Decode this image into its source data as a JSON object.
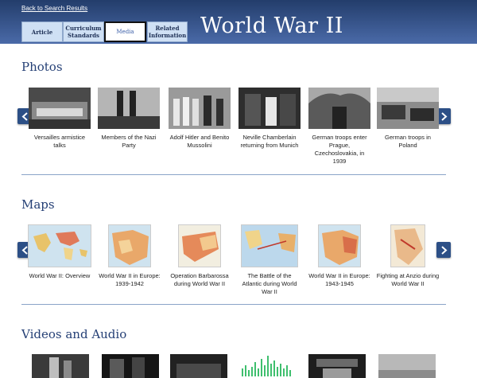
{
  "header": {
    "back_link": "Back to Search Results",
    "title": "World War II",
    "tabs": [
      {
        "label_line1": "Article",
        "label_line2": ""
      },
      {
        "label_line1": "Curriculum",
        "label_line2": "Standards"
      },
      {
        "label_line1": "Media",
        "label_line2": ""
      },
      {
        "label_line1": "Related",
        "label_line2": "Information"
      }
    ],
    "active_tab": "Media"
  },
  "photos": {
    "title": "Photos",
    "items": [
      {
        "caption": "Versailles armistice talks"
      },
      {
        "caption": "Members of the Nazi Party"
      },
      {
        "caption": "Adolf Hitler and Benito Mussolini"
      },
      {
        "caption": "Neville Chamberlain returning from Munich"
      },
      {
        "caption": "German troops enter Prague, Czechoslovakia, in 1939"
      },
      {
        "caption": "German troops in Poland"
      }
    ]
  },
  "maps": {
    "title": "Maps",
    "items": [
      {
        "caption": "World War II: Overview"
      },
      {
        "caption": "World War II in Europe: 1939-1942"
      },
      {
        "caption": "Operation Barbarossa during World War II"
      },
      {
        "caption": "The Battle of the Atlantic during World War II"
      },
      {
        "caption": "World War II in Europe: 1943-1945"
      },
      {
        "caption": "Fighting at Anzio during World War II"
      }
    ]
  },
  "videos": {
    "title": "Videos and Audio"
  },
  "colors": {
    "header_top": "#233d6b",
    "header_bottom": "#4a6aa8",
    "section_title": "#243f75",
    "arrow": "#2c4f86",
    "tab_bg": "#cfe0f4"
  }
}
